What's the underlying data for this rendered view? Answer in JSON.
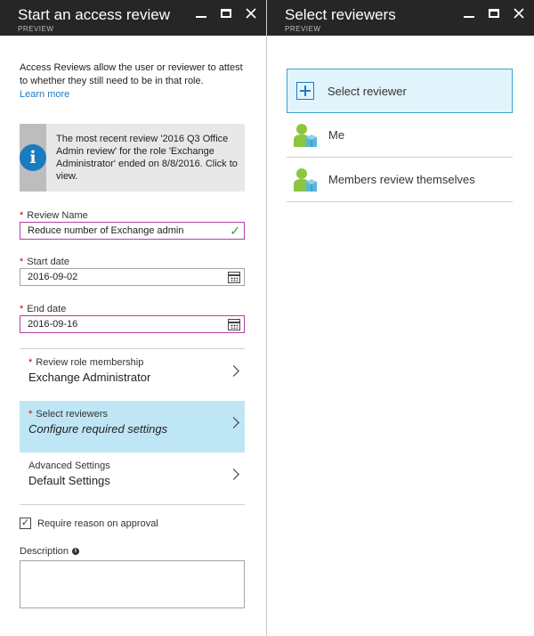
{
  "left_blade": {
    "title": "Start an access review",
    "subtitle": "PREVIEW",
    "intro_text": "Access Reviews allow the user or reviewer to attest to whether they still need to be in that role.",
    "learn_more": "Learn more",
    "info_text": "The most recent review '2016 Q3 Office Admin review' for the role 'Exchange Administrator' ended on 8/8/2016. Click to view.",
    "review_name": {
      "label": "Review Name",
      "value": "Reduce number of Exchange admin"
    },
    "start_date": {
      "label": "Start date",
      "value": "2016-09-02"
    },
    "end_date": {
      "label": "End date",
      "value": "2016-09-16"
    },
    "review_role": {
      "label": "Review role membership",
      "value": "Exchange Administrator"
    },
    "select_reviewers": {
      "label": "Select reviewers",
      "value": "Configure required settings"
    },
    "advanced": {
      "label": "Advanced Settings",
      "value": "Default Settings"
    },
    "require_reason": {
      "label": "Require reason on approval",
      "checked": true
    },
    "description_label": "Description"
  },
  "right_blade": {
    "title": "Select reviewers",
    "subtitle": "PREVIEW",
    "items": [
      {
        "label": "Select reviewer",
        "icon": "plus-icon"
      },
      {
        "label": "Me",
        "icon": "user-icon"
      },
      {
        "label": "Members review themselves",
        "icon": "users-icon"
      }
    ]
  },
  "colors": {
    "header_bg": "#262626",
    "accent": "#1e7ac3",
    "selected_bg": "#bfe6f5",
    "focus_border": "#b33fa0",
    "required": "#cc0000",
    "valid": "#3c9d28"
  }
}
